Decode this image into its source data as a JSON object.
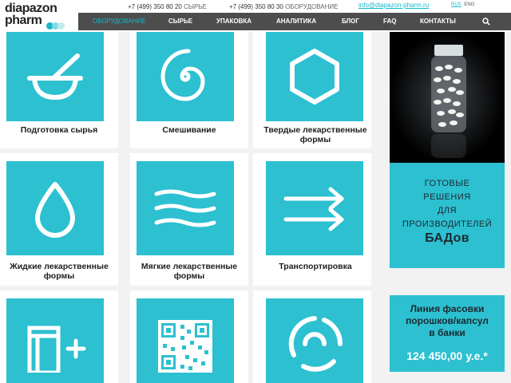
{
  "header": {
    "logo_line1": "diapazon",
    "logo_line2": "pharm",
    "phone1": {
      "number": "+7 (499) 350 80 20",
      "label": "СЫРЬЕ"
    },
    "phone2": {
      "number": "+7 (499) 350 80 30",
      "label": "ОБОРУДОВАНИЕ"
    },
    "email": "info@diapazon-pharm.ru",
    "lang_ru": "RUS",
    "lang_en": "ENG"
  },
  "nav": {
    "items": [
      {
        "label": "ОБОРУДОВАНИЕ"
      },
      {
        "label": "СЫРЬЕ"
      },
      {
        "label": "УПАКОВКА"
      },
      {
        "label": "АНАЛИТИКА"
      },
      {
        "label": "БЛОГ"
      },
      {
        "label": "FAQ"
      },
      {
        "label": "КОНТАКТЫ"
      }
    ],
    "search_icon": "search-icon"
  },
  "categories": [
    {
      "label": "Подготовка сырья",
      "icon": "mortar-pestle-icon"
    },
    {
      "label": "Смешивание",
      "icon": "spiral-icon"
    },
    {
      "label": "Твердые лекарственные формы",
      "icon": "hexagon-icon"
    },
    {
      "label": "Жидкие лекарственные формы",
      "icon": "drop-icon"
    },
    {
      "label": "Мягкие лекарственные формы",
      "icon": "waves-icon"
    },
    {
      "label": "Транспортировка",
      "icon": "arrows-right-icon"
    },
    {
      "label": "",
      "icon": "container-plus-icon"
    },
    {
      "label": "",
      "icon": "qr-code-icon"
    },
    {
      "label": "",
      "icon": "circular-arrows-icon"
    }
  ],
  "side_banner": {
    "line1": "ГОТОВЫЕ",
    "line2": "РЕШЕНИЯ",
    "line3": "ДЛЯ",
    "line4": "ПРОИЗВОДИТЕЛЕЙ",
    "line5": "БАДов"
  },
  "promo": {
    "line1": "Линия фасовки",
    "line2": "порошков/капсул",
    "line3": "в банки",
    "price": "124 450,00 у.е.*"
  },
  "colors": {
    "accent": "#2cc0d1",
    "nav_bg": "#4d4d4d",
    "link": "#17b8c8"
  }
}
